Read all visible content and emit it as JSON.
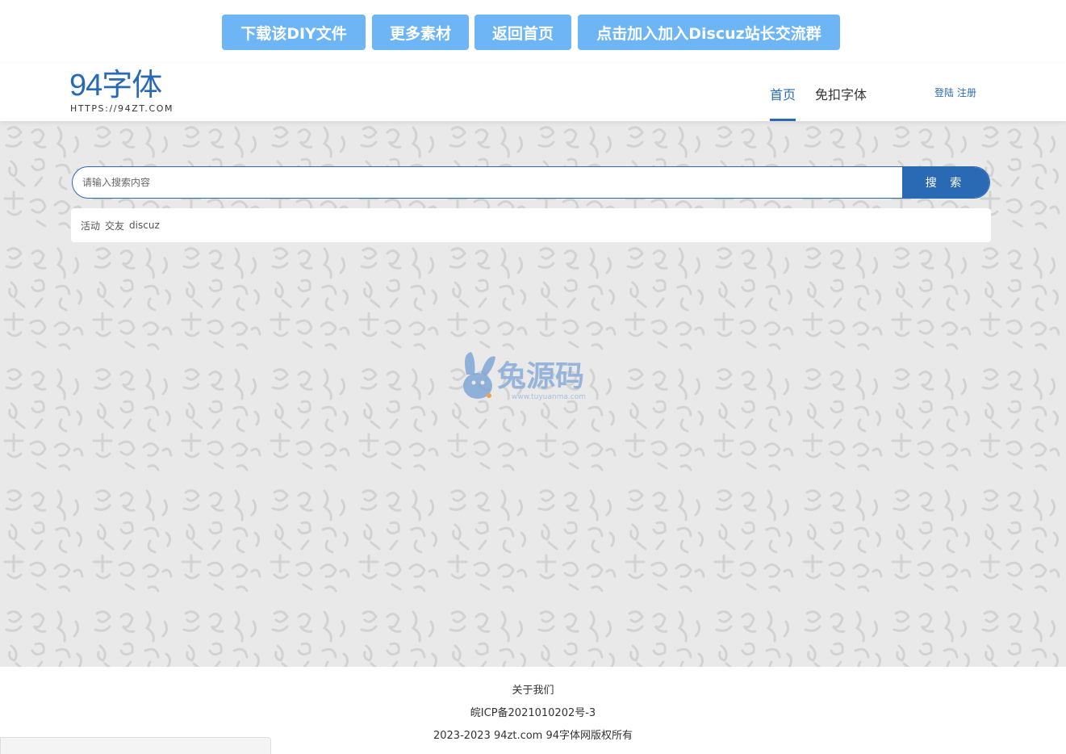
{
  "top_buttons": [
    {
      "label": "下载该DIY文件"
    },
    {
      "label": "更多素材"
    },
    {
      "label": "返回首页"
    },
    {
      "label": "点击加入加入Discuz站长交流群"
    }
  ],
  "logo": {
    "main": "94字体",
    "sub": "HTTPS://94ZT.COM"
  },
  "nav": {
    "home": "首页",
    "free_fonts": "免扣字体"
  },
  "auth": {
    "login": "登陆",
    "register": "注册"
  },
  "search": {
    "placeholder": "请输入搜索内容",
    "button": "搜 索"
  },
  "hot_tags": [
    "活动",
    "交友",
    "discuz"
  ],
  "watermark": {
    "text": "兔源码",
    "url": "www.tuyuanma.com"
  },
  "footer": {
    "about": "关于我们",
    "icp": "皖ICP备2021010202号-3",
    "copyright": "2023-2023 94zt.com 94字体网版权所有"
  },
  "colors": {
    "brand": "#2a6ab5",
    "top_button": "#6db5f5",
    "background": "#e9e9e9"
  }
}
